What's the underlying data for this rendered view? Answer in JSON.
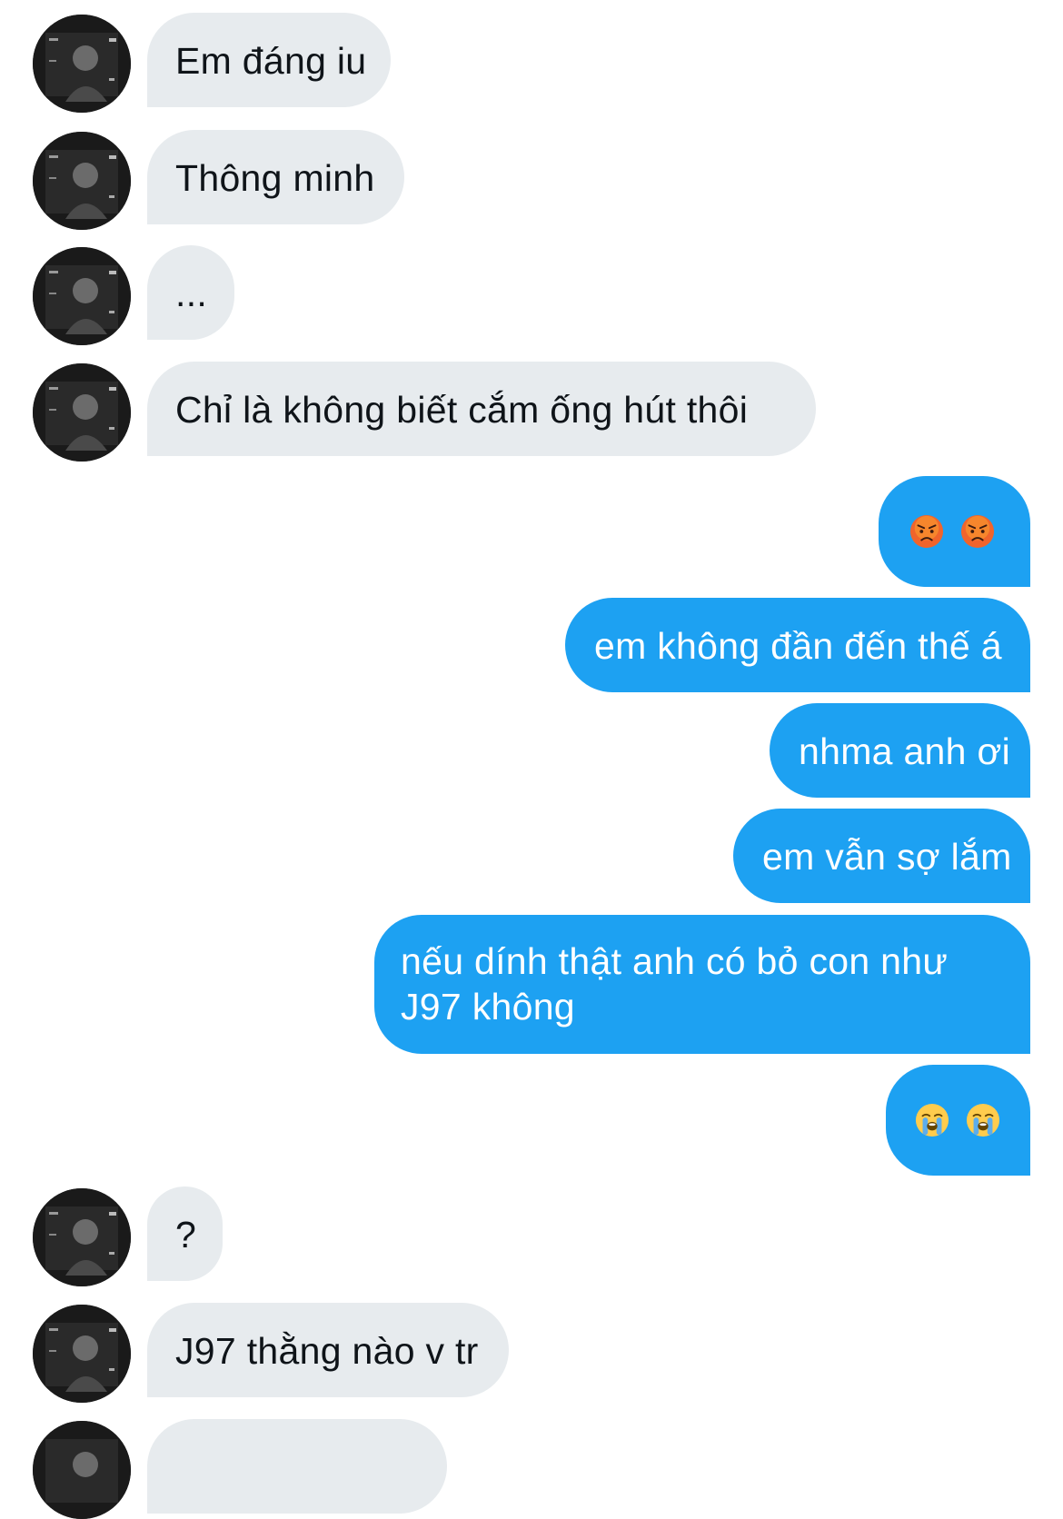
{
  "messages": [
    {
      "from": "them",
      "text": "Em đáng iu"
    },
    {
      "from": "them",
      "text": "Thông minh"
    },
    {
      "from": "them",
      "text": "..."
    },
    {
      "from": "them",
      "text": "Chỉ là không biết cắm ống hút thôi"
    },
    {
      "from": "me",
      "emoji": [
        "pouting-face-emoji",
        "pouting-face-emoji"
      ]
    },
    {
      "from": "me",
      "text": "em không đần đến thế á"
    },
    {
      "from": "me",
      "text": "nhma anh ơi"
    },
    {
      "from": "me",
      "text": "em vẫn sợ lắm"
    },
    {
      "from": "me",
      "text_line1": "nếu dính thật anh có bỏ con như",
      "text_line2": "J97 không"
    },
    {
      "from": "me",
      "emoji": [
        "loudly-crying-face-emoji",
        "loudly-crying-face-emoji"
      ]
    },
    {
      "from": "them",
      "text": "?"
    },
    {
      "from": "them",
      "text": "J97 thằng nào v tr"
    }
  ],
  "colors": {
    "incoming_bubble": "#e7ebee",
    "incoming_text": "#0f1419",
    "outgoing_bubble": "#1da1f2",
    "outgoing_text": "#ffffff"
  }
}
